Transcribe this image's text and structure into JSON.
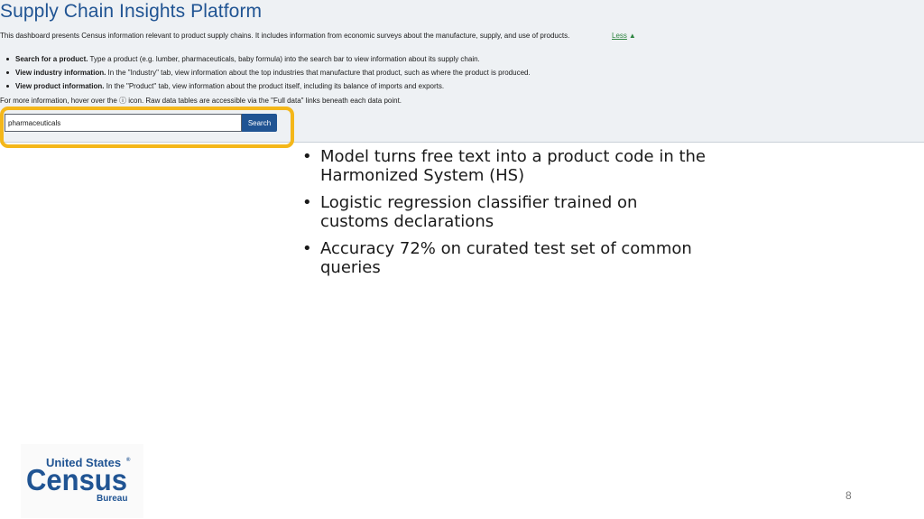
{
  "app": {
    "title": "Supply Chain Insights Platform",
    "intro": "This dashboard presents Census information relevant to product supply chains. It includes information from economic surveys about the manufacture, supply, and use of products.",
    "less_link": "Less",
    "less_icon": "triangle-up-icon",
    "bullets": [
      {
        "bold": "Search for a product.",
        "text": " Type a product (e.g. lumber, pharmaceuticals, baby formula) into the search bar to view information about its supply chain."
      },
      {
        "bold": "View industry information.",
        "text": " In the \"Industry\" tab, view information about the top industries that manufacture that product, such as where the product is produced."
      },
      {
        "bold": "View product information.",
        "text": " In the \"Product\" tab, view information about the product itself, including its balance of imports and exports."
      }
    ],
    "more_info": "For more information, hover over the ⓘ icon. Raw data tables are accessible via the \"Full data\" links beneath each data point.",
    "search": {
      "value": "pharmaceuticals",
      "button": "Search"
    }
  },
  "highlight_color": "#f4b71a",
  "slide": {
    "points": [
      "Model turns free text into a product code in the Harmonized System (HS)",
      "Logistic regression classifier trained on customs declarations",
      "Accuracy 72% on curated test set of common queries"
    ],
    "page_number": "8"
  },
  "logo": {
    "line1": "United States",
    "registered": "®",
    "line2": "Census",
    "line3": "Bureau",
    "color": "#205493"
  }
}
